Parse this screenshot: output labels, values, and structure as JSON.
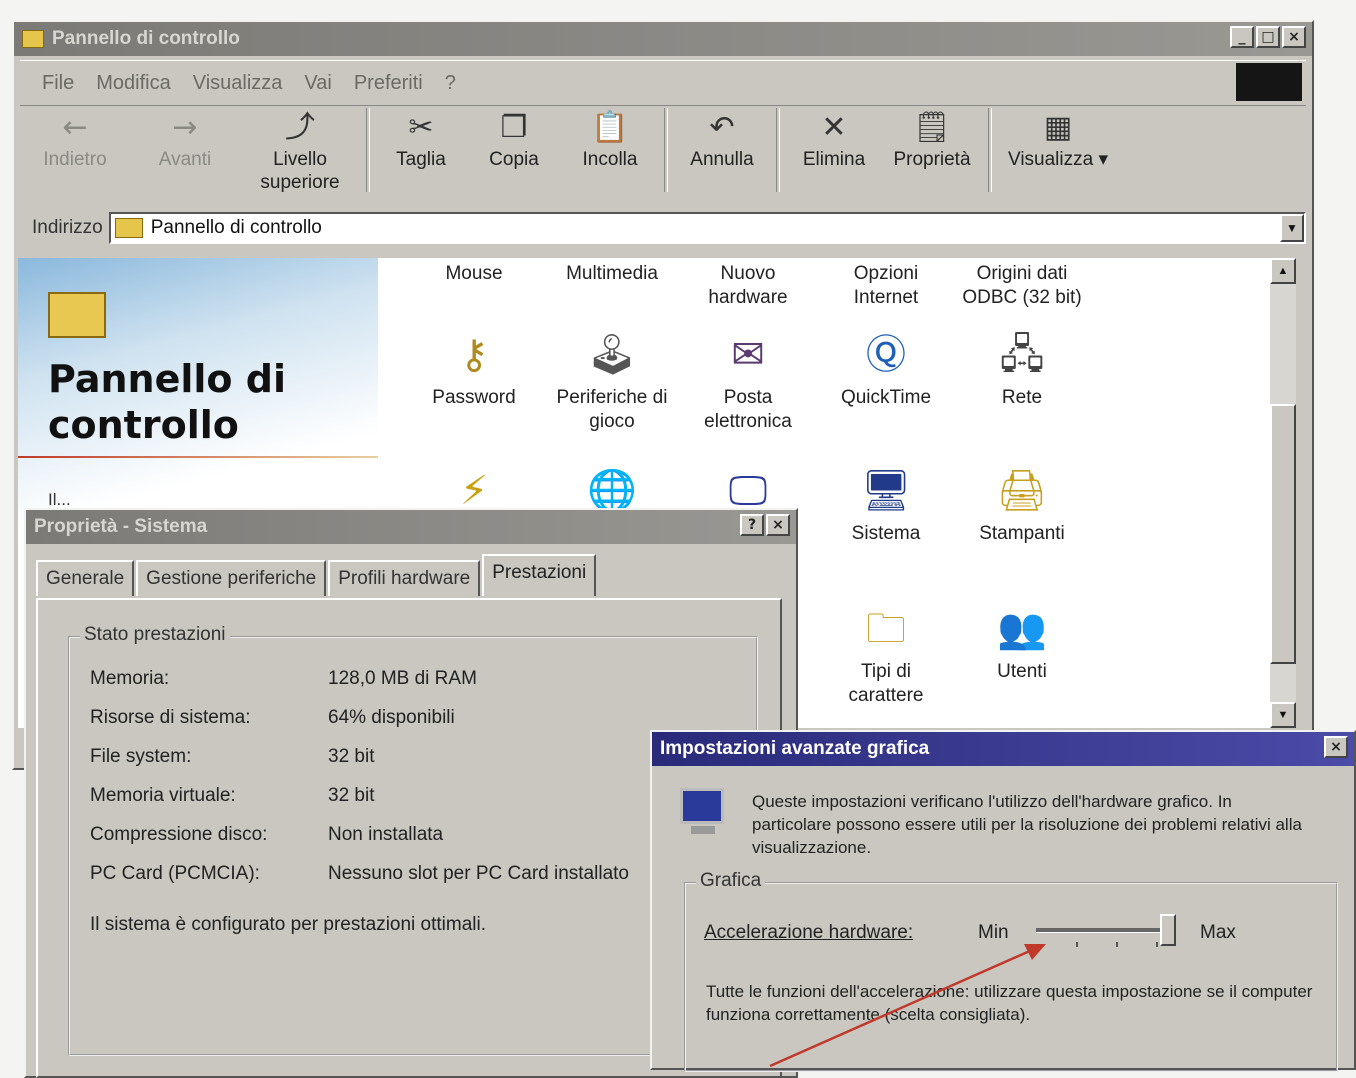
{
  "explorer": {
    "title": "Pannello di controllo",
    "menu": [
      "File",
      "Modifica",
      "Visualizza",
      "Vai",
      "Preferiti",
      "?"
    ],
    "toolbar": {
      "back": "Indietro",
      "forward": "Avanti",
      "up": "Livello superiore",
      "cut": "Taglia",
      "copy": "Copia",
      "paste": "Incolla",
      "undo": "Annulla",
      "delete": "Elimina",
      "properties": "Proprietà",
      "view": "Visualizza"
    },
    "address": {
      "label": "Indirizzo",
      "value": "Pannello di controllo"
    },
    "panel_title": "Pannello di controllo",
    "panel_subtext": "Il...",
    "applets_row1": [
      "Mouse",
      "Multimedia",
      "Nuovo hardware",
      "Opzioni Internet",
      "Origini dati ODBC (32 bit)"
    ],
    "applets_row2": [
      {
        "label": "Password",
        "icon": "keys-icon"
      },
      {
        "label": "Periferiche di gioco",
        "icon": "joystick-icon"
      },
      {
        "label": "Posta elettronica",
        "icon": "mail-icon"
      },
      {
        "label": "QuickTime",
        "icon": "quicktime-icon"
      },
      {
        "label": "Rete",
        "icon": "network-icon"
      }
    ],
    "applets_row3": [
      {
        "label": "Sistema",
        "icon": "computer-icon"
      },
      {
        "label": "Stampanti",
        "icon": "printer-folder-icon"
      }
    ],
    "applets_row4": [
      {
        "label": "Tipi di carattere",
        "icon": "fonts-folder-icon"
      },
      {
        "label": "Utenti",
        "icon": "users-icon"
      }
    ]
  },
  "system_props": {
    "title": "Proprietà - Sistema",
    "tabs": [
      "Generale",
      "Gestione periferiche",
      "Profili hardware",
      "Prestazioni"
    ],
    "selected_tab": "Prestazioni",
    "group_label": "Stato prestazioni",
    "rows": [
      {
        "key": "Memoria:",
        "value": "128,0 MB di RAM"
      },
      {
        "key": "Risorse di sistema:",
        "value": "64% disponibili"
      },
      {
        "key": "File system:",
        "value": "32 bit"
      },
      {
        "key": "Memoria virtuale:",
        "value": "32 bit"
      },
      {
        "key": "Compressione disco:",
        "value": "Non installata"
      },
      {
        "key": "PC Card (PCMCIA):",
        "value": "Nessuno slot per PC Card installato"
      }
    ],
    "status_message": "Il sistema è configurato per prestazioni ottimali."
  },
  "graphics_dialog": {
    "title": "Impostazioni avanzate grafica",
    "description": "Queste impostazioni verificano l'utilizzo dell'hardware grafico. In particolare possono essere utili per la risoluzione dei problemi relativi alla visualizzazione.",
    "group_label": "Grafica",
    "slider_label": "Accelerazione hardware:",
    "slider_min": "Min",
    "slider_max": "Max",
    "slider_level": 1.0,
    "slider_hint": "Tutte le funzioni dell'accelerazione: utilizzare questa impostazione se il computer funziona correttamente (scelta consigliata)."
  },
  "colors": {
    "window_face": "#c9c7c0",
    "active_title": "#2a2a7a",
    "arrow": "#c0392b"
  }
}
